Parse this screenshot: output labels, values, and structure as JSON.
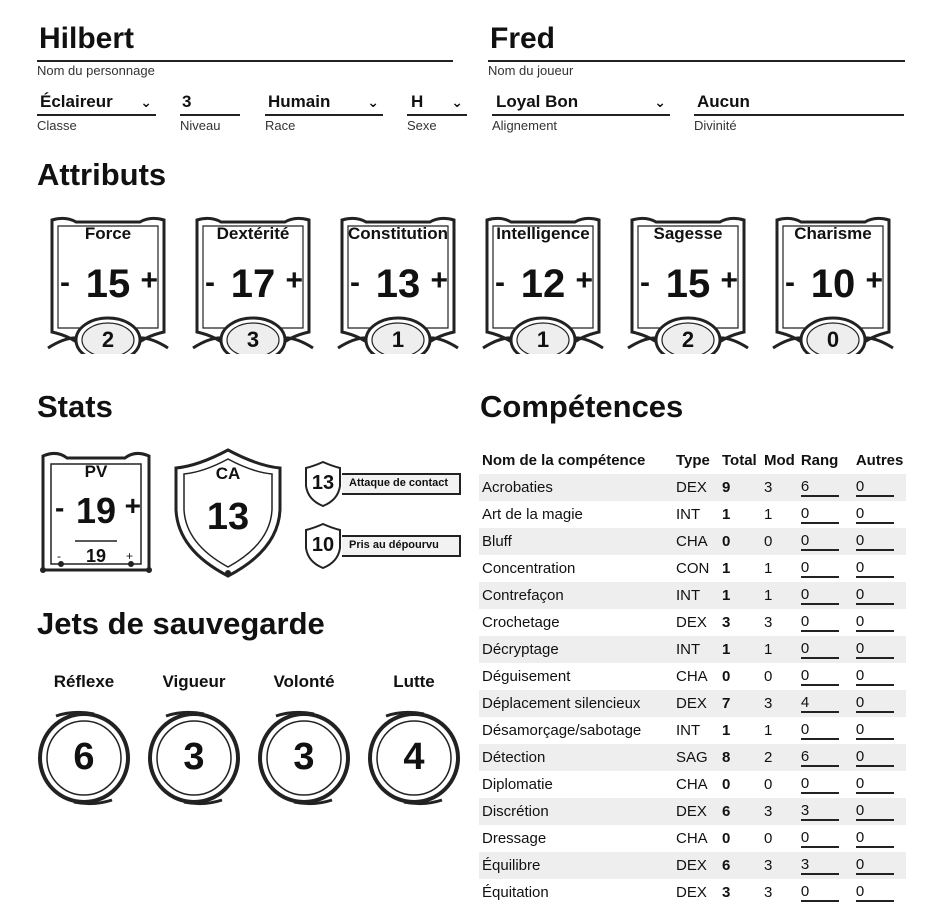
{
  "header": {
    "character_name": "Hilbert",
    "character_name_label": "Nom du personnage",
    "player_name": "Fred",
    "player_name_label": "Nom du joueur",
    "fields": [
      {
        "value": "Éclaireur",
        "label": "Classe"
      },
      {
        "value": "3",
        "label": "Niveau"
      },
      {
        "value": "Humain",
        "label": "Race"
      },
      {
        "value": "H",
        "label": "Sexe"
      },
      {
        "value": "Loyal Bon",
        "label": "Alignement"
      },
      {
        "value": "Aucun",
        "label": "Divinité"
      }
    ]
  },
  "attributes": {
    "title": "Attributs",
    "items": [
      {
        "name": "Force",
        "score": "15",
        "mod": "2"
      },
      {
        "name": "Dextérité",
        "score": "17",
        "mod": "3"
      },
      {
        "name": "Constitution",
        "score": "13",
        "mod": "1"
      },
      {
        "name": "Intelligence",
        "score": "12",
        "mod": "1"
      },
      {
        "name": "Sagesse",
        "score": "15",
        "mod": "2"
      },
      {
        "name": "Charisme",
        "score": "10",
        "mod": "0"
      }
    ],
    "minus": "-",
    "plus": "+"
  },
  "stats": {
    "title": "Stats",
    "hp_label": "PV",
    "hp_value": "19",
    "hp_max": "19",
    "ac_label": "CA",
    "ac_value": "13",
    "touch_value": "13",
    "touch_label": "Attaque de contact",
    "flat_value": "10",
    "flat_label": "Pris au dépourvu"
  },
  "saves": {
    "title": "Jets de sauvegarde",
    "items": [
      {
        "name": "Réflexe",
        "value": "6"
      },
      {
        "name": "Vigueur",
        "value": "3"
      },
      {
        "name": "Volonté",
        "value": "3"
      },
      {
        "name": "Lutte",
        "value": "4"
      }
    ]
  },
  "skills": {
    "title": "Compétences",
    "headers": [
      "Nom de la compétence",
      "Type",
      "Total",
      "Mod",
      "Rang",
      "Autres"
    ],
    "rows": [
      [
        "Acrobaties",
        "DEX",
        "9",
        "3",
        "6",
        "0"
      ],
      [
        "Art de la magie",
        "INT",
        "1",
        "1",
        "0",
        "0"
      ],
      [
        "Bluff",
        "CHA",
        "0",
        "0",
        "0",
        "0"
      ],
      [
        "Concentration",
        "CON",
        "1",
        "1",
        "0",
        "0"
      ],
      [
        "Contrefaçon",
        "INT",
        "1",
        "1",
        "0",
        "0"
      ],
      [
        "Crochetage",
        "DEX",
        "3",
        "3",
        "0",
        "0"
      ],
      [
        "Décryptage",
        "INT",
        "1",
        "1",
        "0",
        "0"
      ],
      [
        "Déguisement",
        "CHA",
        "0",
        "0",
        "0",
        "0"
      ],
      [
        "Déplacement silencieux",
        "DEX",
        "7",
        "3",
        "4",
        "0"
      ],
      [
        "Désamorçage/sabotage",
        "INT",
        "1",
        "1",
        "0",
        "0"
      ],
      [
        "Détection",
        "SAG",
        "8",
        "2",
        "6",
        "0"
      ],
      [
        "Diplomatie",
        "CHA",
        "0",
        "0",
        "0",
        "0"
      ],
      [
        "Discrétion",
        "DEX",
        "6",
        "3",
        "3",
        "0"
      ],
      [
        "Dressage",
        "CHA",
        "0",
        "0",
        "0",
        "0"
      ],
      [
        "Équilibre",
        "DEX",
        "6",
        "3",
        "3",
        "0"
      ],
      [
        "Équitation",
        "DEX",
        "3",
        "3",
        "0",
        "0"
      ]
    ]
  },
  "icons": {
    "dropdown": "chevron-down-icon"
  },
  "colors": {
    "ink": "#222222",
    "row_shade": "#eeeeee"
  }
}
